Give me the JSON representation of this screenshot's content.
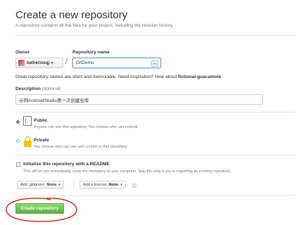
{
  "header": {
    "title": "Create a new repository",
    "subtitle": "A repository contains all the files for your project, including the revision history."
  },
  "owner": {
    "label": "Owner",
    "value": "katherineqj"
  },
  "repository_name": {
    "label": "Repository name",
    "value": "GitDemo"
  },
  "name_hint": {
    "prefix": "Great repository names are short and memorable. Need inspiration? How about",
    "suggestion": "fictional-guacamole",
    "suffix": "."
  },
  "description": {
    "label": "Description",
    "optional": "(optional)",
    "value": "示例AndroidStudio第一次创建仓库"
  },
  "visibility": {
    "public": {
      "title": "Public",
      "desc": "Anyone can see this repository. You choose who can commit.",
      "selected": true
    },
    "private": {
      "title": "Private",
      "desc": "You choose who can see and commit to this repository.",
      "selected": false
    }
  },
  "initialize": {
    "title": "Initialize this repository with a README",
    "desc": "This will let you immediately clone the repository to your computer. Skip this step if you're importing an existing repository.",
    "checked": false
  },
  "gitignore": {
    "label": "Add .gitignore:",
    "value": "None"
  },
  "license": {
    "label": "Add a license:",
    "value": "None"
  },
  "submit": {
    "label": "Create repository"
  },
  "colors": {
    "primary_green": "#60b044",
    "focus_blue": "#51a7e8",
    "annotation_red": "#e00000"
  }
}
